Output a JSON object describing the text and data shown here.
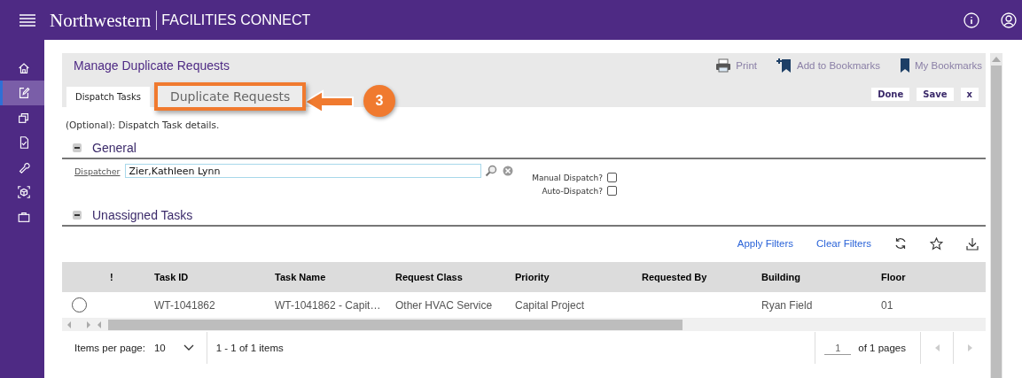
{
  "header": {
    "brand": "Northwestern",
    "product": "FACILITIES CONNECT"
  },
  "sidebar": {
    "items": [
      {
        "kind": "home",
        "selected": false
      },
      {
        "kind": "edit",
        "selected": true
      },
      {
        "kind": "copy",
        "selected": false
      },
      {
        "kind": "document",
        "selected": false
      },
      {
        "kind": "wrench",
        "selected": false
      },
      {
        "kind": "cube",
        "selected": false
      },
      {
        "kind": "briefcase",
        "selected": false
      }
    ]
  },
  "page": {
    "title": "Manage Duplicate Requests",
    "actions": [
      {
        "kind": "print",
        "label": "Print"
      },
      {
        "kind": "add-bookmark",
        "label": "Add to Bookmarks"
      },
      {
        "kind": "bookmark",
        "label": "My Bookmarks"
      }
    ],
    "tabs": [
      {
        "label": "Dispatch Tasks",
        "selected": true,
        "highlighted": false
      },
      {
        "label": "Duplicate Requests",
        "selected": false,
        "highlighted": true
      }
    ],
    "buttons": [
      "Done",
      "Save",
      "x"
    ]
  },
  "annotation": {
    "number": "3"
  },
  "hint": "(Optional): Dispatch Task details.",
  "general": {
    "title": "General",
    "expanded": true,
    "dispatcher": {
      "label": "Dispatcher",
      "value": "Zier,Kathleen Lynn"
    },
    "checkboxes": [
      {
        "label": "Manual Dispatch?",
        "checked": false
      },
      {
        "label": "Auto-Dispatch?",
        "checked": false
      }
    ]
  },
  "unassigned": {
    "title": "Unassigned Tasks",
    "expanded": true,
    "links": [
      "Apply Filters",
      "Clear Filters"
    ],
    "table": {
      "columns": [
        "!",
        "Task ID",
        "Task Name",
        "Request Class",
        "Priority",
        "Requested By",
        "Building",
        "Floor"
      ],
      "rows": [
        {
          "selected": false,
          "cells": [
            null,
            "WT-1041862",
            "WT-1041862 - Capit…",
            "Other HVAC Service",
            "Capital Project",
            null,
            "Ryan Field",
            "01"
          ]
        }
      ]
    },
    "pager": {
      "items_per_page_label": "Items per page:",
      "page_size": "10",
      "summary": "1 - 1 of 1 items",
      "page": "1",
      "of_pages": "of 1 pages"
    }
  }
}
